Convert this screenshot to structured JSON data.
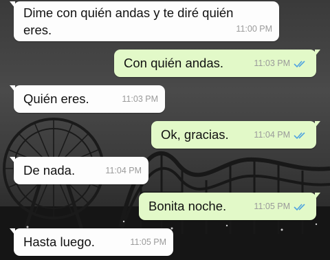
{
  "messages": [
    {
      "direction": "in",
      "line1": "Dime con quién andas y te diré  quién",
      "line2": "eres.",
      "time": "11:00 PM"
    },
    {
      "direction": "out",
      "text": "Con quién andas.",
      "time": "11:03 PM",
      "status_icon": "double-check-icon"
    },
    {
      "direction": "in",
      "text": "Quién eres.",
      "time": "11:03 PM"
    },
    {
      "direction": "out",
      "text": "Ok, gracias.",
      "time": "11:04 PM",
      "status_icon": "double-check-icon"
    },
    {
      "direction": "in",
      "text": "De nada.",
      "time": "11:04 PM"
    },
    {
      "direction": "out",
      "text": "Bonita noche.",
      "time": "11:05 PM",
      "status_icon": "double-check-icon"
    },
    {
      "direction": "in",
      "text": "Hasta luego.",
      "time": "11:05 PM"
    }
  ],
  "colors": {
    "incoming_bubble": "#fdfdfd",
    "outgoing_bubble": "#e2f9c8",
    "read_check": "#4fa3e0",
    "timestamp": "#9a9a9a"
  },
  "background_scene": "night-amusement-park-wallpaper"
}
